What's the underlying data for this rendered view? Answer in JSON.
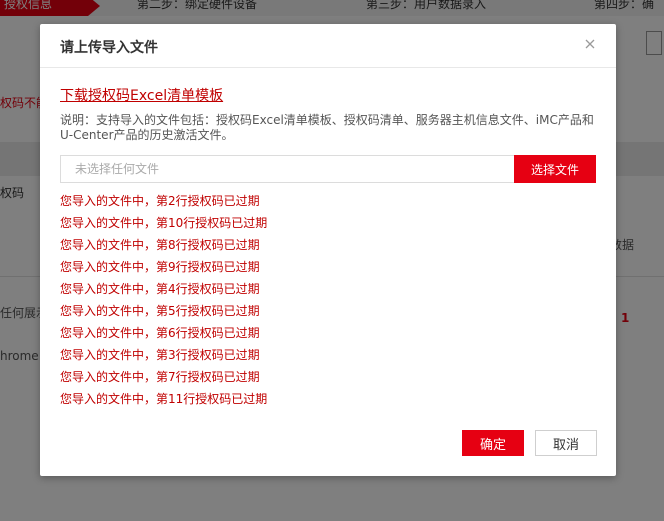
{
  "background": {
    "steps": {
      "active_label": "授权信息",
      "step2_label": "第二步：绑定硬件设备",
      "step3_label": "第三步：用户数据录入",
      "step4_label": "第四步：确"
    },
    "red_text": "权码不能",
    "column_header": "权码",
    "no_data": "数据",
    "display_text": "任何展示",
    "page_number": "1",
    "chrome_text": "hrome"
  },
  "modal": {
    "title": "请上传导入文件",
    "download_link": "下载授权码Excel清单模板",
    "description": "说明：支持导入的文件包括：授权码Excel清单模板、授权码清单、服务器主机信息文件、iMC产品和U-Center产品的历史激活文件。",
    "file_input": {
      "value": "",
      "placeholder": "未选择任何文件"
    },
    "select_file_label": "选择文件",
    "errors": [
      "您导入的文件中，第2行授权码已过期",
      "您导入的文件中，第10行授权码已过期",
      "您导入的文件中，第8行授权码已过期",
      "您导入的文件中，第9行授权码已过期",
      "您导入的文件中，第4行授权码已过期",
      "您导入的文件中，第5行授权码已过期",
      "您导入的文件中，第6行授权码已过期",
      "您导入的文件中，第3行授权码已过期",
      "您导入的文件中，第7行授权码已过期",
      "您导入的文件中，第11行授权码已过期"
    ],
    "confirm_label": "确定",
    "cancel_label": "取消"
  },
  "icons": {
    "close": "close-icon"
  },
  "colors": {
    "accent": "#e60012",
    "error_text": "#c00000",
    "overlay": "rgba(0,0,0,0.5)"
  }
}
